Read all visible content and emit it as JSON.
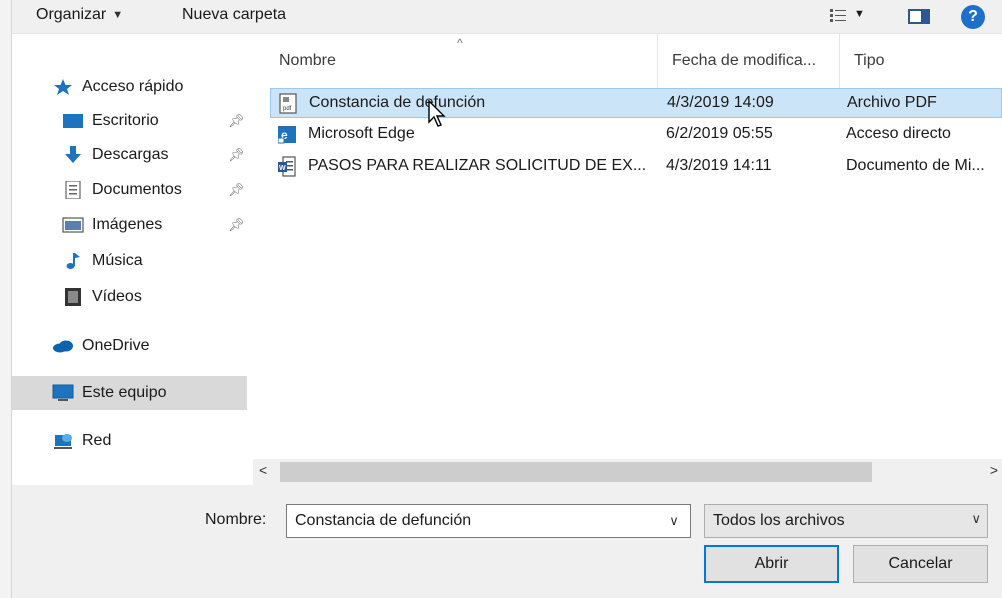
{
  "toolbar": {
    "organize_label": "Organizar",
    "new_folder_label": "Nueva carpeta",
    "help_label": "?"
  },
  "sidebar": {
    "items": [
      {
        "label": "Acceso rápido",
        "icon": "star-icon",
        "pinned": false
      },
      {
        "label": "Escritorio",
        "icon": "desktop-icon",
        "pinned": true
      },
      {
        "label": "Descargas",
        "icon": "download-arrow-icon",
        "pinned": true
      },
      {
        "label": "Documentos",
        "icon": "document-icon",
        "pinned": true
      },
      {
        "label": "Imágenes",
        "icon": "image-icon",
        "pinned": true
      },
      {
        "label": "Música",
        "icon": "music-note-icon",
        "pinned": false
      },
      {
        "label": "Vídeos",
        "icon": "film-icon",
        "pinned": false
      },
      {
        "label": "OneDrive",
        "icon": "cloud-icon",
        "pinned": false
      },
      {
        "label": "Este equipo",
        "icon": "computer-icon",
        "pinned": false,
        "selected": true
      },
      {
        "label": "Red",
        "icon": "network-icon",
        "pinned": false
      }
    ]
  },
  "file_list": {
    "columns": [
      "Nombre",
      "Fecha de modifica...",
      "Tipo"
    ],
    "rows": [
      {
        "name": "Constancia de defunción",
        "date": "4/3/2019 14:09",
        "type": "Archivo PDF",
        "icon": "pdf-file-icon",
        "selected": true
      },
      {
        "name": "Microsoft Edge",
        "date": "6/2/2019 05:55",
        "type": "Acceso directo",
        "icon": "edge-shortcut-icon",
        "selected": false
      },
      {
        "name": "PASOS PARA REALIZAR SOLICITUD DE EX...",
        "date": "4/3/2019 14:11",
        "type": "Documento de Mi...",
        "icon": "word-document-icon",
        "selected": false
      }
    ]
  },
  "bottom": {
    "filename_label": "Nombre:",
    "filename_value": "Constancia de defunción",
    "file_type_value": "Todos los archivos",
    "open_button": "Abrir",
    "cancel_button": "Cancelar"
  },
  "colors": {
    "selection": "#cce4f7",
    "accent": "#0078d7"
  }
}
